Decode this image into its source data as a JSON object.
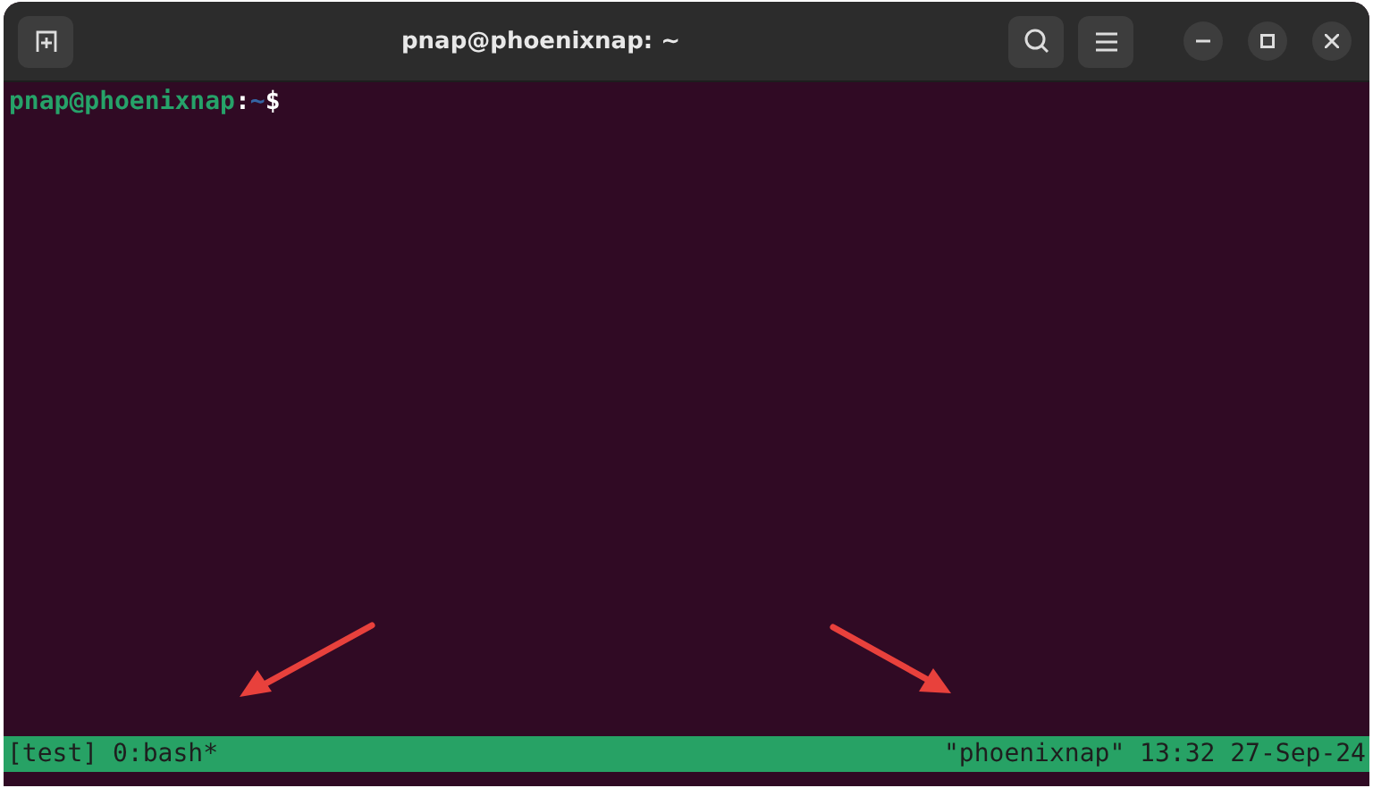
{
  "window": {
    "title": "pnap@phoenixnap: ~"
  },
  "terminal": {
    "prompt": [
      {
        "kind": "userhost",
        "text": "pnap@phoenixnap"
      },
      {
        "kind": "plain",
        "text": ":"
      },
      {
        "kind": "path",
        "text": "~"
      },
      {
        "kind": "plain",
        "text": "$"
      }
    ]
  },
  "status_bar": {
    "left": "[test] 0:bash*",
    "right": "\"phoenixnap\" 13:32 27-Sep-24"
  }
}
